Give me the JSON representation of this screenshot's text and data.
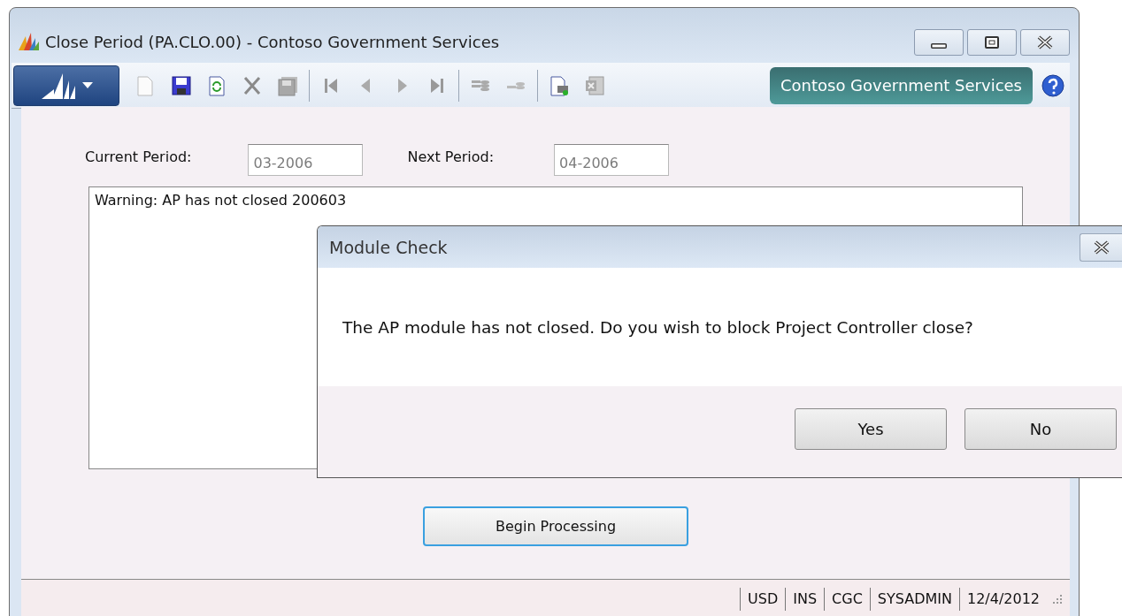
{
  "window": {
    "title": "Close Period (PA.CLO.00) - Contoso Government Services"
  },
  "toolbar": {
    "company": "Contoso Government Services"
  },
  "fields": [
    {
      "label": "Current Period:",
      "value": "03-2006",
      "disabled": true
    },
    {
      "label": "Next Period:",
      "value": "04-2006",
      "disabled": true
    }
  ],
  "messages": [
    "Warning: AP has not closed 200603"
  ],
  "action_button": "Begin Processing",
  "status_bar": [
    "USD",
    "INS",
    "CGC",
    "SYSADMIN",
    "12/4/2012"
  ],
  "dialog": {
    "title": "Module Check",
    "message": "The AP module has not closed. Do you wish to block Project Controller close?",
    "buttons": [
      "Yes",
      "No"
    ]
  }
}
